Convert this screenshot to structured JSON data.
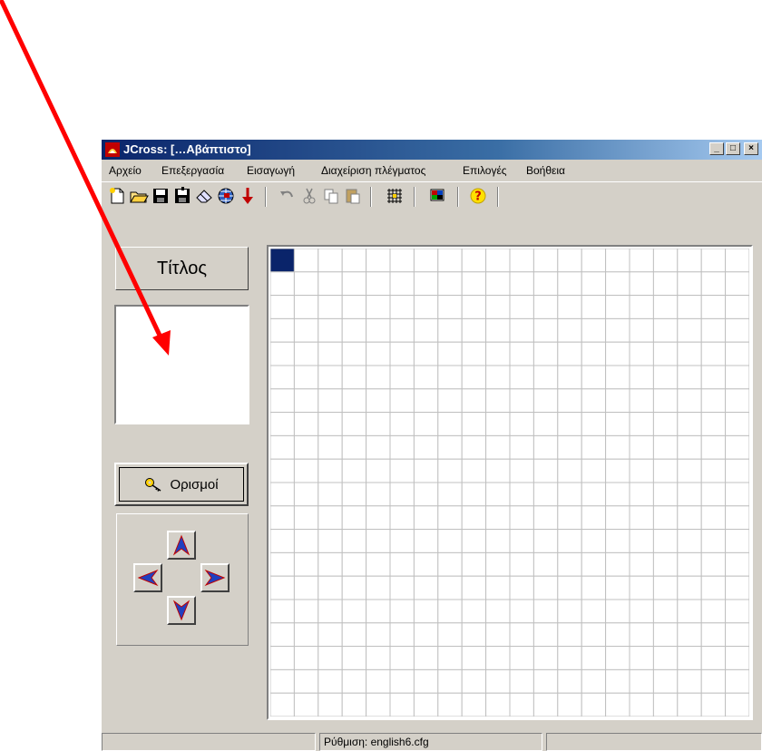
{
  "window": {
    "title": "JCross: […Αβάπτιστο]",
    "controls": {
      "minimize": "_",
      "maximize": "□",
      "close": "×"
    }
  },
  "menu": [
    "Αρχείο",
    "Επεξεργασία",
    "Εισαγωγή",
    "Διαχείριση πλέγματος",
    "Επιλογές",
    "Βοήθεια"
  ],
  "toolbar": {
    "icons": [
      "new-file-icon",
      "open-folder-icon",
      "save-icon",
      "save-as-icon",
      "eraser-icon",
      "web-export-icon",
      "download-arrow-icon",
      "undo-icon",
      "cut-icon",
      "copy-icon",
      "paste-icon",
      "grid-icon",
      "colors-icon",
      "help-icon"
    ],
    "help_glyph": "?"
  },
  "left_panel": {
    "title_button": "Τίτλος",
    "title_value": "",
    "definitions_button": "Ορισμοί",
    "arrow_icons": [
      "arrow-up-icon",
      "arrow-left-icon",
      "arrow-right-icon",
      "arrow-down-icon"
    ]
  },
  "grid": {
    "rows": 20,
    "cols": 20,
    "selected_cell": {
      "row": 0,
      "col": 0
    },
    "selected_color": "#0a246a"
  },
  "status_bar": [
    "",
    "Ρύθμιση: english6.cfg",
    ""
  ],
  "colors": {
    "annotation_arrow": "#ff0000",
    "titlebar": "#0a246a",
    "face": "#d4d0c8"
  }
}
